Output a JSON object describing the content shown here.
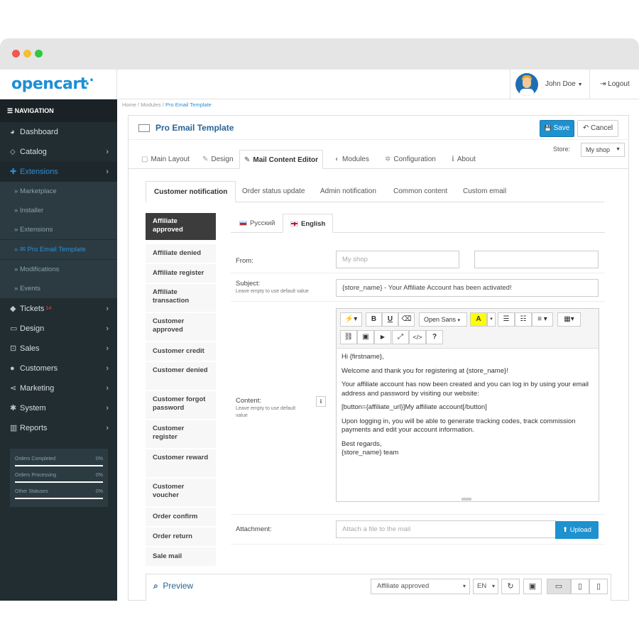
{
  "browser": {
    "dots": [
      "#ee5a52",
      "#f5bf30",
      "#2fc840"
    ]
  },
  "header": {
    "logo": "opencart",
    "logo_cart": ".̃ ",
    "user_name": "John Doe",
    "logout": "Logout"
  },
  "sidebar": {
    "title": "NAVIGATION",
    "items": [
      {
        "label": "Dashboard",
        "icon": "dashboard-icon",
        "glyph": "◕"
      },
      {
        "label": "Catalog",
        "icon": "tag-icon",
        "glyph": "⬦"
      },
      {
        "label": "Extensions",
        "icon": "puzzle-icon",
        "glyph": "✚"
      },
      {
        "label": "Tickets",
        "icon": "ticket-icon",
        "glyph": "◆",
        "badge": "14"
      },
      {
        "label": "Design",
        "icon": "monitor-icon",
        "glyph": "▭"
      },
      {
        "label": "Sales",
        "icon": "cart-icon",
        "glyph": "⊡"
      },
      {
        "label": "Customers",
        "icon": "user-icon",
        "glyph": "●"
      },
      {
        "label": "Marketing",
        "icon": "share-icon",
        "glyph": "⋖"
      },
      {
        "label": "System",
        "icon": "gear-icon",
        "glyph": "✱"
      },
      {
        "label": "Reports",
        "icon": "bar-chart-icon",
        "glyph": "▥"
      }
    ],
    "sub_items": [
      "Marketplace",
      "Installer",
      "Extensions",
      "Pro Email Template",
      "Modifications",
      "Events"
    ],
    "stats": [
      {
        "label": "Orders Completed",
        "value": "0%"
      },
      {
        "label": "Orders Processing",
        "value": "0%"
      },
      {
        "label": "Other Statuses",
        "value": "0%"
      }
    ]
  },
  "breadcrumb": {
    "home": "Home",
    "modules": "Modules",
    "current": "Pro Email Template",
    "sep": "/"
  },
  "page": {
    "title": "Pro Email Template",
    "save": "Save",
    "cancel": "Cancel",
    "save_icon": "💾",
    "cancel_icon": "↶",
    "tabs": [
      "Main Layout",
      "Design",
      "Mail Content Editor",
      "Modules",
      "Configuration",
      "About"
    ],
    "tab_glyphs": [
      "▢",
      "✎",
      "✎",
      "◐",
      "✲",
      "ℹ"
    ],
    "store_label": "Store:",
    "store_value": "My shop"
  },
  "sub_tabs": [
    "Customer notification",
    "Order status update",
    "Admin notification",
    "Common content",
    "Custom email"
  ],
  "templates": [
    "Affiliate approved",
    "Affiliate denied",
    "Affiliate register",
    "Affiliate transaction",
    "Customer approved",
    "Customer credit",
    "Customer denied",
    "Customer forgot password",
    "Customer register",
    "Customer reward",
    "Customer voucher",
    "Order confirm",
    "Order return",
    "Sale mail"
  ],
  "languages": [
    "Русский",
    "English"
  ],
  "form": {
    "from_label": "From:",
    "from_placeholder": "My shop",
    "subject_label": "Subject:",
    "subject_hint": "Leave empty to use default value",
    "subject_value": "{store_name} - Your Affiliate Account has been activated!",
    "content_label": "Content:",
    "content_hint": "Leave empty to use default value",
    "info_glyph": "i",
    "attachment_label": "Attachment:",
    "attachment_placeholder": "Attach a file to the mail",
    "upload": "Upload",
    "upload_icon": "⬆"
  },
  "editor": {
    "font": "Open Sans",
    "toolbar": {
      "magic": "⚡▾",
      "bold": "B",
      "underline": "U",
      "eraser": "⌫",
      "font_caret": "▾",
      "color": "A",
      "color_caret": "▾",
      "ul": "☰",
      "ol": "☷",
      "align": "≡ ▾",
      "table": "▦▾",
      "link": "⛓",
      "picture": "▣",
      "video": "▶",
      "fullscreen": "⤢",
      "code": "</>",
      "help": "?"
    },
    "body": [
      "Hi {firstname},",
      "Welcome and thank you for registering at {store_name}!",
      "Your affiliate account has now been created and you can log in by using your email address and password by visiting our website:",
      "[button={affiliate_url}]My affiliate account[/button]",
      "Upon logging in, you will be able to generate tracking codes, track commission payments and edit your account information.",
      "Best regards,",
      "{store_name} team"
    ]
  },
  "preview": {
    "title": "Preview",
    "search_icon": "⌕",
    "template_select": "Affiliate approved",
    "lang_select": "EN",
    "caret": "▾",
    "buttons": {
      "refresh": "↻",
      "image": "▣",
      "desktop": "▭",
      "tablet": "▯",
      "mobile": "▯"
    }
  },
  "colors": {
    "accent": "#1e91cf",
    "sidebar": "#222d32",
    "active_link": "#2a8fd6"
  }
}
